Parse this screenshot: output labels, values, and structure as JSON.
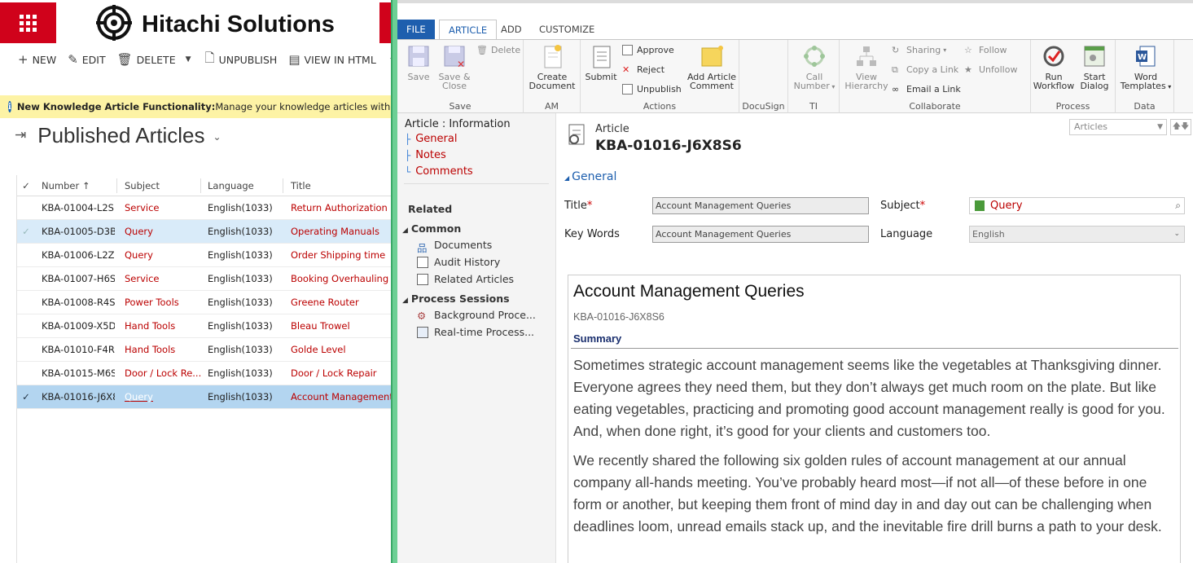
{
  "left": {
    "brand": "Hitachi Solutions",
    "commands": [
      "NEW",
      "EDIT",
      "DELETE",
      "UNPUBLISH",
      "VIEW IN HTML"
    ],
    "notice_bold": "New Knowledge Article Functionality:",
    "notice_text": " Manage your knowledge articles with a new edit",
    "view_title": "Published Articles",
    "columns": [
      "Number ↑",
      "Subject",
      "Language",
      "Title"
    ],
    "rows": [
      {
        "number": "KBA-01004-L2S...",
        "subject": "Service",
        "language": "English(1033)",
        "title": "Return Authorization"
      },
      {
        "number": "KBA-01005-D3B...",
        "subject": "Query",
        "language": "English(1033)",
        "title": "Operating Manuals"
      },
      {
        "number": "KBA-01006-L2Z...",
        "subject": "Query",
        "language": "English(1033)",
        "title": "Order Shipping time"
      },
      {
        "number": "KBA-01007-H6S...",
        "subject": "Service",
        "language": "English(1033)",
        "title": "Booking Overhauling Se"
      },
      {
        "number": "KBA-01008-R4S...",
        "subject": "Power Tools",
        "language": "English(1033)",
        "title": "Greene Router"
      },
      {
        "number": "KBA-01009-X5D...",
        "subject": "Hand Tools",
        "language": "English(1033)",
        "title": "Bleau Trowel"
      },
      {
        "number": "KBA-01010-F4R...",
        "subject": "Hand Tools",
        "language": "English(1033)",
        "title": "Golde Level"
      },
      {
        "number": "KBA-01015-M6S...",
        "subject": "Door / Lock Re...",
        "language": "English(1033)",
        "title": "Door / Lock Repair"
      },
      {
        "number": "KBA-01016-J6X8...",
        "subject": "Query",
        "language": "English(1033)",
        "title": "Account Management Q"
      }
    ]
  },
  "ribbon": {
    "tabs": [
      "FILE",
      "ARTICLE",
      "ADD",
      "CUSTOMIZE"
    ],
    "save": {
      "save": "Save",
      "save_close_1": "Save &",
      "save_close_2": "Close",
      "delete": "Delete",
      "label": "Save"
    },
    "am": {
      "create_1": "Create",
      "create_2": "Document",
      "label": "AM"
    },
    "actions": {
      "submit": "Submit",
      "approve": "Approve",
      "reject": "Reject",
      "unpublish": "Unpublish",
      "add_1": "Add Article",
      "add_2": "Comment",
      "label": "Actions"
    },
    "docusign": {
      "label": "DocuSign"
    },
    "ti": {
      "call_1": "Call",
      "call_2": "Number",
      "label": "TI"
    },
    "collaborate": {
      "hier_1": "View",
      "hier_2": "Hierarchy",
      "sharing": "Sharing",
      "copy": "Copy a Link",
      "email": "Email a Link",
      "follow": "Follow",
      "unfollow": "Unfollow",
      "label": "Collaborate"
    },
    "process": {
      "run_1": "Run",
      "run_2": "Workflow",
      "start_1": "Start",
      "start_2": "Dialog",
      "label": "Process"
    },
    "data": {
      "word_1": "Word",
      "word_2": "Templates",
      "label": "Data"
    }
  },
  "nav": {
    "title": "Article : Information",
    "links": [
      "General",
      "Notes",
      "Comments"
    ],
    "related": "Related",
    "common": "Common",
    "common_items": [
      "Documents",
      "Audit History",
      "Related Articles"
    ],
    "process_sessions": "Process Sessions",
    "process_items": [
      "Background Proce...",
      "Real-time Process..."
    ]
  },
  "form": {
    "entity": "Article",
    "record": "KBA-01016-J6X8S6",
    "form_selector": "Articles",
    "section": "General",
    "title_label": "Title",
    "title_value": "Account Management Queries",
    "keywords_label": "Key Words",
    "keywords_value": "Account Management Queries",
    "subject_label": "Subject",
    "subject_value": "Query",
    "language_label": "Language",
    "language_value": "English",
    "content": {
      "title": "Account Management Queries",
      "id": "KBA-01016-J6X8S6",
      "summary": "Summary",
      "para1": "Sometimes strategic account management seems like the vegetables at Thanksgiving dinner. Everyone agrees they need them, but they don’t always get much room on the plate. But like eating vegetables, practicing and promoting good account management really is good for you. And, when done right, it’s good for your clients and customers too.",
      "para2": "We recently shared the following six golden rules of account management at our annual company all-hands meeting. You’ve probably heard most—if not all—of these before in one form or another, but keeping them front of mind day in and day out can be challenging when deadlines loom, unread emails stack up, and the inevitable fire drill burns a path to your desk."
    }
  }
}
